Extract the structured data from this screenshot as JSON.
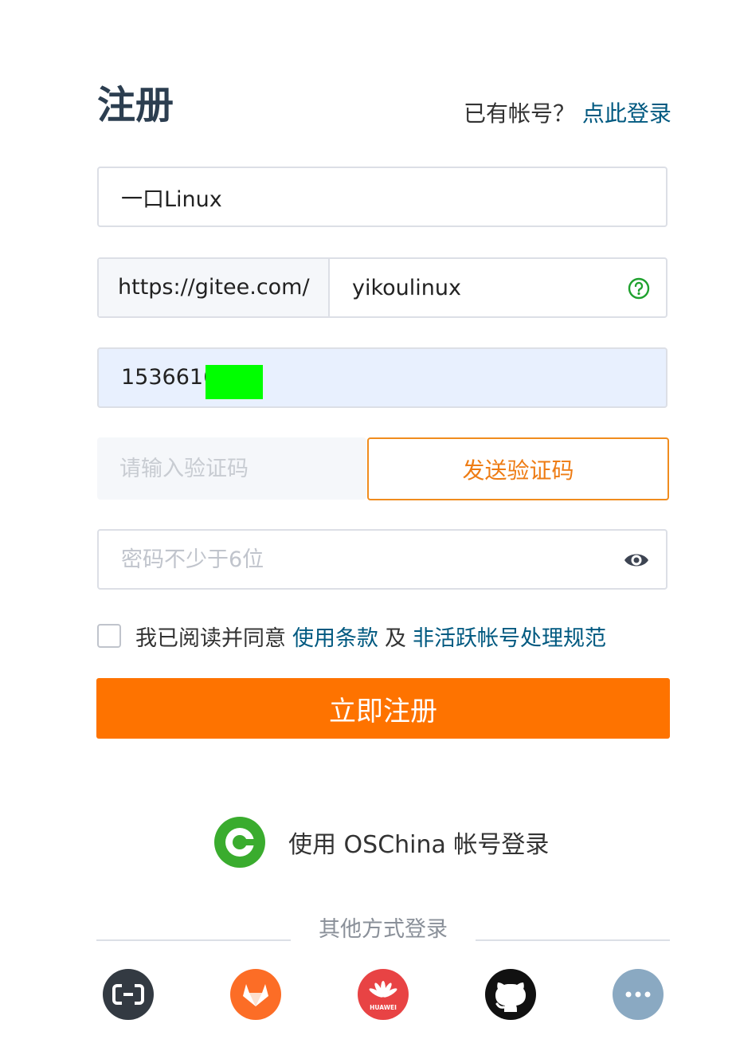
{
  "header": {
    "title": "注册",
    "have_account_text": "已有帐号？",
    "login_link": "点此登录"
  },
  "form": {
    "name_value": "一口Linux",
    "url_prefix": "https://gitee.com/",
    "url_value": "yikoulinux",
    "phone_value": "1536616",
    "code_placeholder": "请输入验证码",
    "send_code_label": "发送验证码",
    "password_placeholder": "密码不少于6位",
    "agree_text": "我已阅读并同意",
    "terms_link": "使用条款",
    "and_text": "及",
    "policy_link": "非活跃帐号处理规范",
    "submit_label": "立即注册"
  },
  "oauth": {
    "oschina_label": "使用 OSChina 帐号登录",
    "other_label": "其他方式登录",
    "providers": [
      {
        "icon": "aliyun-icon",
        "color": "#333a42"
      },
      {
        "icon": "gitlab-icon",
        "color": "#fc6d26"
      },
      {
        "icon": "huawei-icon",
        "color": "#e84344",
        "label": "HUAWEI"
      },
      {
        "icon": "github-icon",
        "color": "#111111"
      },
      {
        "icon": "more-icon",
        "color": "#8aa9c2"
      }
    ]
  },
  "colors": {
    "accent": "#fe7300",
    "link": "#005980",
    "send_code": "#ee7c14",
    "help_icon": "#1fa12e",
    "oschina_green": "#3aac2e"
  }
}
